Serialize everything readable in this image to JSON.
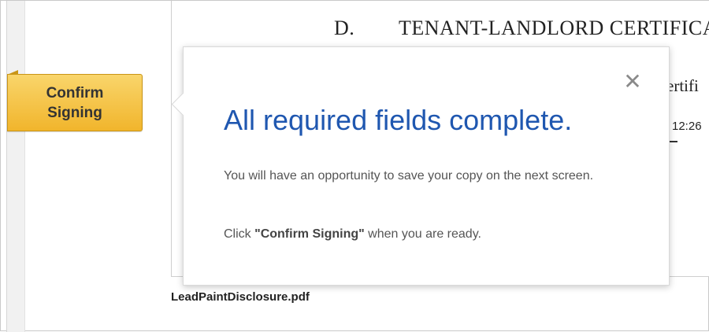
{
  "document": {
    "heading_letter": "D.",
    "heading_text": "TENANT-LANDLORD CERTIFICA",
    "partial_word": "ertifi",
    "partial_time": "12:26",
    "file_name": "LeadPaintDisclosure.pdf"
  },
  "confirm_tab": {
    "line1": "Confirm",
    "line2": "Signing"
  },
  "popup": {
    "close_symbol": "✕",
    "title": "All required fields complete.",
    "message": "You will have an opportunity to save your copy on the next screen.",
    "hint_prefix": "Click ",
    "hint_bold": "\"Confirm Signing\"",
    "hint_suffix": " when you are ready."
  },
  "colors": {
    "tab_fill": "#f1b52c",
    "title_blue": "#1f57b0"
  }
}
